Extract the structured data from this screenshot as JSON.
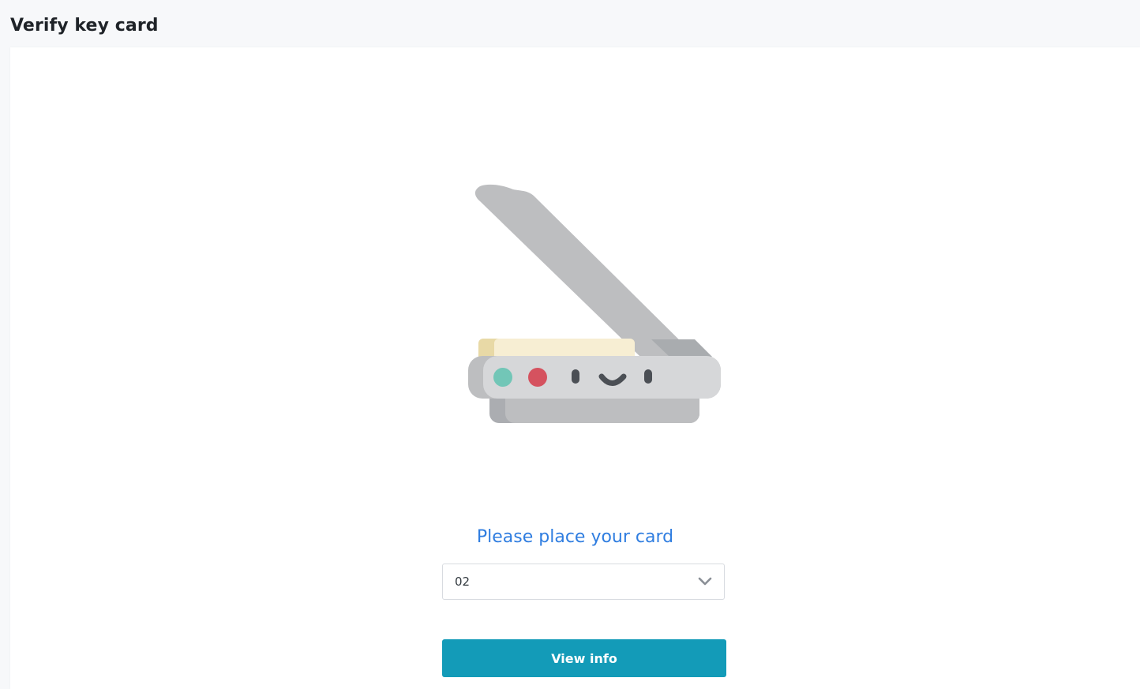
{
  "page": {
    "title": "Verify key card"
  },
  "scanner": {
    "prompt": "Please place your card",
    "icon": "scanner-icon"
  },
  "reader_select": {
    "selected_value": "02",
    "icon": "chevron-down-icon"
  },
  "actions": {
    "view_info_label": "View info"
  },
  "colors": {
    "prompt_text": "#2f7de0",
    "button_bg": "#139bb8",
    "page_bg": "#f7f8fa",
    "card_bg": "#ffffff"
  }
}
